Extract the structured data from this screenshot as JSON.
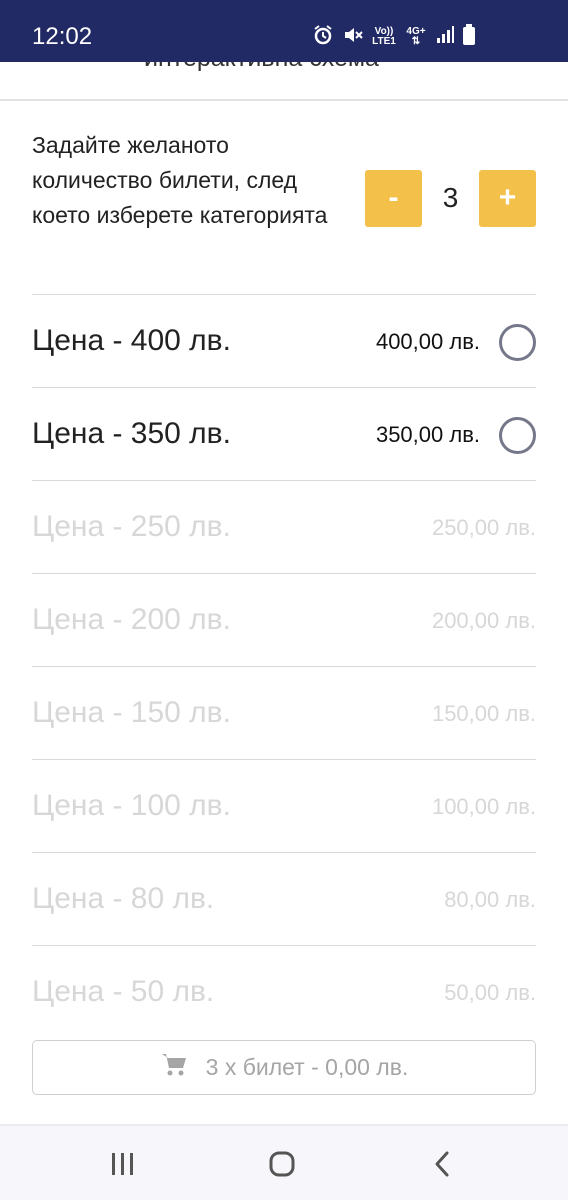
{
  "status_bar": {
    "time": "12:02",
    "network_top": "Vo))",
    "network_bottom": "LTE1",
    "signal_label": "4G+"
  },
  "header": {
    "partial_title": "интерактивна схема"
  },
  "quantity": {
    "instruction": "Задайте желаното количество билети, след което изберете категорията",
    "minus_label": "-",
    "value": "3",
    "plus_label": "+"
  },
  "price_categories": [
    {
      "name": "Цена - 400 лв.",
      "amount": "400,00 лв.",
      "enabled": true
    },
    {
      "name": "Цена - 350 лв.",
      "amount": "350,00 лв.",
      "enabled": true
    },
    {
      "name": "Цена - 250 лв.",
      "amount": "250,00 лв.",
      "enabled": false
    },
    {
      "name": "Цена - 200 лв.",
      "amount": "200,00 лв.",
      "enabled": false
    },
    {
      "name": "Цена - 150 лв.",
      "amount": "150,00 лв.",
      "enabled": false
    },
    {
      "name": "Цена - 100 лв.",
      "amount": "100,00 лв.",
      "enabled": false
    },
    {
      "name": "Цена - 80 лв.",
      "amount": "80,00 лв.",
      "enabled": false
    },
    {
      "name": "Цена - 50 лв.",
      "amount": "50,00 лв.",
      "enabled": false
    }
  ],
  "cart": {
    "label": "3 x билет - 0,00 лв.",
    "icon": "shopping-cart-icon"
  },
  "navigation": {
    "recent_icon": "recent-apps-icon",
    "home_icon": "home-icon",
    "back_icon": "back-icon"
  },
  "colors": {
    "status_bar": "#222a66",
    "accent": "#f3c04a",
    "disabled_text": "#d7d7d7"
  }
}
